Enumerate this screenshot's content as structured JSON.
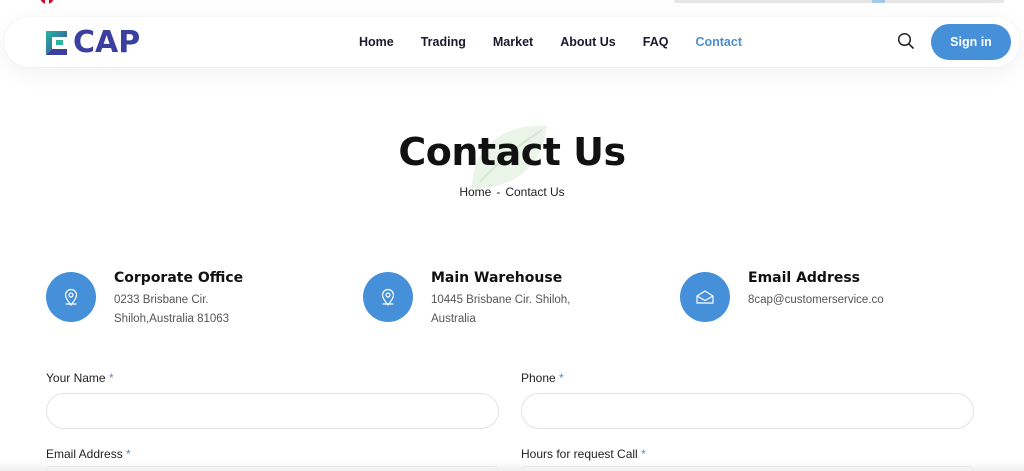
{
  "brand": {
    "logo_text": "CAP",
    "accent_color": "#4590d8",
    "logo_color": "#3a3fa0"
  },
  "nav": {
    "links": [
      {
        "label": "Home",
        "active": false
      },
      {
        "label": "Trading",
        "active": false
      },
      {
        "label": "Market",
        "active": false
      },
      {
        "label": "About Us",
        "active": false
      },
      {
        "label": "FAQ",
        "active": false
      },
      {
        "label": "Contact",
        "active": true
      }
    ],
    "search_icon": "search-icon",
    "signin_label": "Sign in"
  },
  "hero": {
    "title": "Contact Us",
    "breadcrumb": {
      "home": "Home",
      "separator": "-",
      "current": "Contact Us"
    }
  },
  "info_cards": [
    {
      "icon": "location-pin-icon",
      "title": "Corporate Office",
      "lines": [
        "0233 Brisbane Cir.",
        "Shiloh,Australia 81063"
      ]
    },
    {
      "icon": "location-pin-icon",
      "title": "Main Warehouse",
      "lines": [
        "10445 Brisbane Cir. Shiloh,",
        "Australia"
      ]
    },
    {
      "icon": "envelope-icon",
      "title": "Email Address",
      "lines": [
        "8cap@customerservice.co"
      ]
    }
  ],
  "form": {
    "required_mark": "*",
    "fields": {
      "name": {
        "label": "Your Name",
        "value": "",
        "placeholder": ""
      },
      "phone": {
        "label": "Phone",
        "value": "",
        "placeholder": ""
      },
      "email": {
        "label": "Email Address",
        "value": "",
        "placeholder": ""
      },
      "hours": {
        "label": "Hours for request Call",
        "value": "",
        "placeholder": ""
      }
    }
  }
}
